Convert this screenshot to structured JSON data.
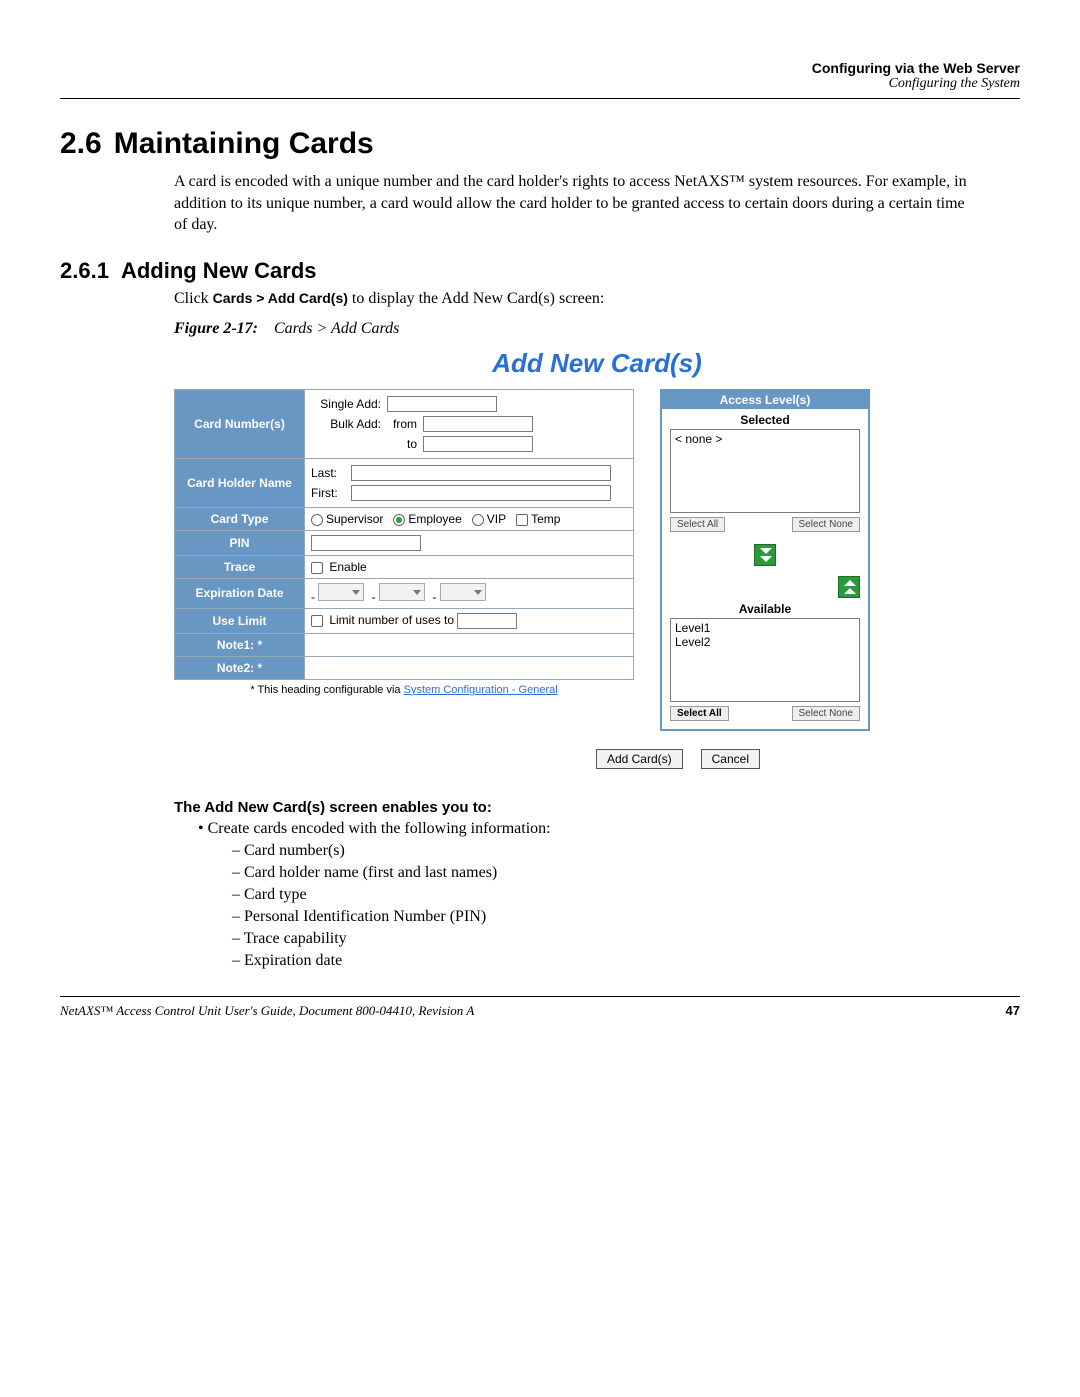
{
  "header": {
    "line1": "Configuring via the Web Server",
    "line2": "Configuring the System"
  },
  "section": {
    "num": "2.6",
    "title": "Maintaining Cards",
    "body": "A card is encoded with a unique number and the card holder's rights to access NetAXS™ system resources. For example, in addition to its unique number, a card would allow the card holder to be granted access to certain doors during a certain time of day."
  },
  "subsection": {
    "num": "2.6.1",
    "title": "Adding New Cards",
    "click_prefix": "Click ",
    "click_path": "Cards > Add Card(s)",
    "click_suffix": " to display the Add New Card(s) screen:"
  },
  "figure": {
    "label": "Figure 2-17:",
    "caption": "Cards > Add Cards"
  },
  "screenshot": {
    "title": "Add New Card(s)",
    "rows": {
      "card_numbers": "Card Number(s)",
      "card_holder": "Card Holder Name",
      "card_type": "Card Type",
      "pin": "PIN",
      "trace": "Trace",
      "expiration": "Expiration Date",
      "use_limit": "Use Limit",
      "note1": "Note1: *",
      "note2": "Note2: *"
    },
    "labels": {
      "single_add": "Single Add:",
      "bulk_add": "Bulk Add:",
      "from": "from",
      "to": "to",
      "last": "Last:",
      "first": "First:",
      "enable": "Enable",
      "limit": "Limit number of uses to"
    },
    "card_types": {
      "supervisor": "Supervisor",
      "employee": "Employee",
      "vip": "VIP",
      "temp": "Temp"
    },
    "footnote_prefix": "* This heading configurable via ",
    "footnote_link": "System Configuration - General",
    "access": {
      "title": "Access Level(s)",
      "selected": "Selected",
      "none": "< none >",
      "available": "Available",
      "levels": [
        "Level1",
        "Level2"
      ],
      "select_all": "Select All",
      "select_none": "Select None"
    },
    "buttons": {
      "add": "Add Card(s)",
      "cancel": "Cancel"
    }
  },
  "enables": {
    "heading": "The Add New Card(s) screen enables you to:",
    "top": "Create cards encoded with the following information:",
    "items": [
      "Card number(s)",
      "Card holder name (first and last names)",
      "Card type",
      "Personal Identification Number (PIN)",
      "Trace capability",
      "Expiration date"
    ]
  },
  "footer": {
    "doc": "NetAXS™ Access Control Unit User's Guide, Document 800-04410, Revision A",
    "page": "47"
  }
}
